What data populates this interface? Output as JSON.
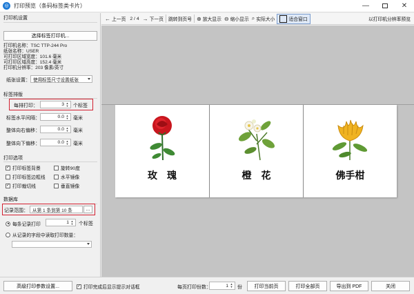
{
  "window": {
    "title": "打印预览（条码标签类卡片）",
    "minimize": "—",
    "close": "✕"
  },
  "printer_settings": {
    "section": "打印机设置",
    "select_button": "选择标签打印机...",
    "info": [
      "打印机名称：TSC TTP-244 Pro",
      "纸张名称：USER",
      "可打印区域宽度：101.6 毫米",
      "可打印区域高度：152.4 毫米",
      "打印机分辨率：203 像素/英寸"
    ],
    "paper_label": "纸张设置：",
    "paper_value": "使用标签尺寸设置纸张"
  },
  "label_layout": {
    "section": "标签排版",
    "per_row_label": "每排打印：",
    "per_row_value": "3",
    "per_row_unit": "个标签",
    "h_spacing_label": "标签水平间隔：",
    "h_spacing_value": "0.0",
    "down_offset_label": "整体向右偏移：",
    "down_offset_value": "0.0",
    "right_offset_label": "整体向下偏移：",
    "right_offset_value": "0.0",
    "unit_mm": "毫米"
  },
  "print_options": {
    "section": "打印选项",
    "print_bg": "打印标签背景",
    "rotate90": "旋转90度",
    "print_border": "打印标签边框线",
    "h_mirror": "水平镜像",
    "print_cutline": "打印裁切线",
    "v_mirror": "垂直镜像"
  },
  "database": {
    "section": "数据库",
    "range_label": "记录范围：",
    "range_value": "从第 1 条到第 10 条",
    "range_btn": "...",
    "each_record_label": "每条记录打印",
    "each_record_value": "1",
    "each_record_unit": "个标签",
    "from_field_label": "从记录的字段中读取打印数量："
  },
  "toolbar": {
    "prev": "上一页",
    "page_indicator": "2 / 4",
    "next": "下一页",
    "jump": "跳转到页号",
    "zoom_in": "放大显示",
    "zoom_out": "缩小显示",
    "actual_size": "实际大小",
    "fit_window": "适合窗口",
    "preview_mode": "以打印机分辨率预览"
  },
  "labels": [
    {
      "name": "玫　瑰",
      "icon": "rose-illustration"
    },
    {
      "name": "橙　花",
      "icon": "orange-blossom-illustration"
    },
    {
      "name": "佛手柑",
      "icon": "bergamot-illustration"
    }
  ],
  "bottom": {
    "advanced": "高级打印参数设置...",
    "show_dialog": "打印完成后显示提示对话框",
    "copies_label": "每页打印份数：",
    "copies_value": "1",
    "copies_unit": "份",
    "print_current": "打印当前页",
    "print_all": "打印全部页",
    "export_pdf": "导出到 PDF",
    "close": "关闭"
  },
  "colors": {
    "highlight_red": "#d21f2f",
    "preview_bg": "#c4c4c4"
  }
}
